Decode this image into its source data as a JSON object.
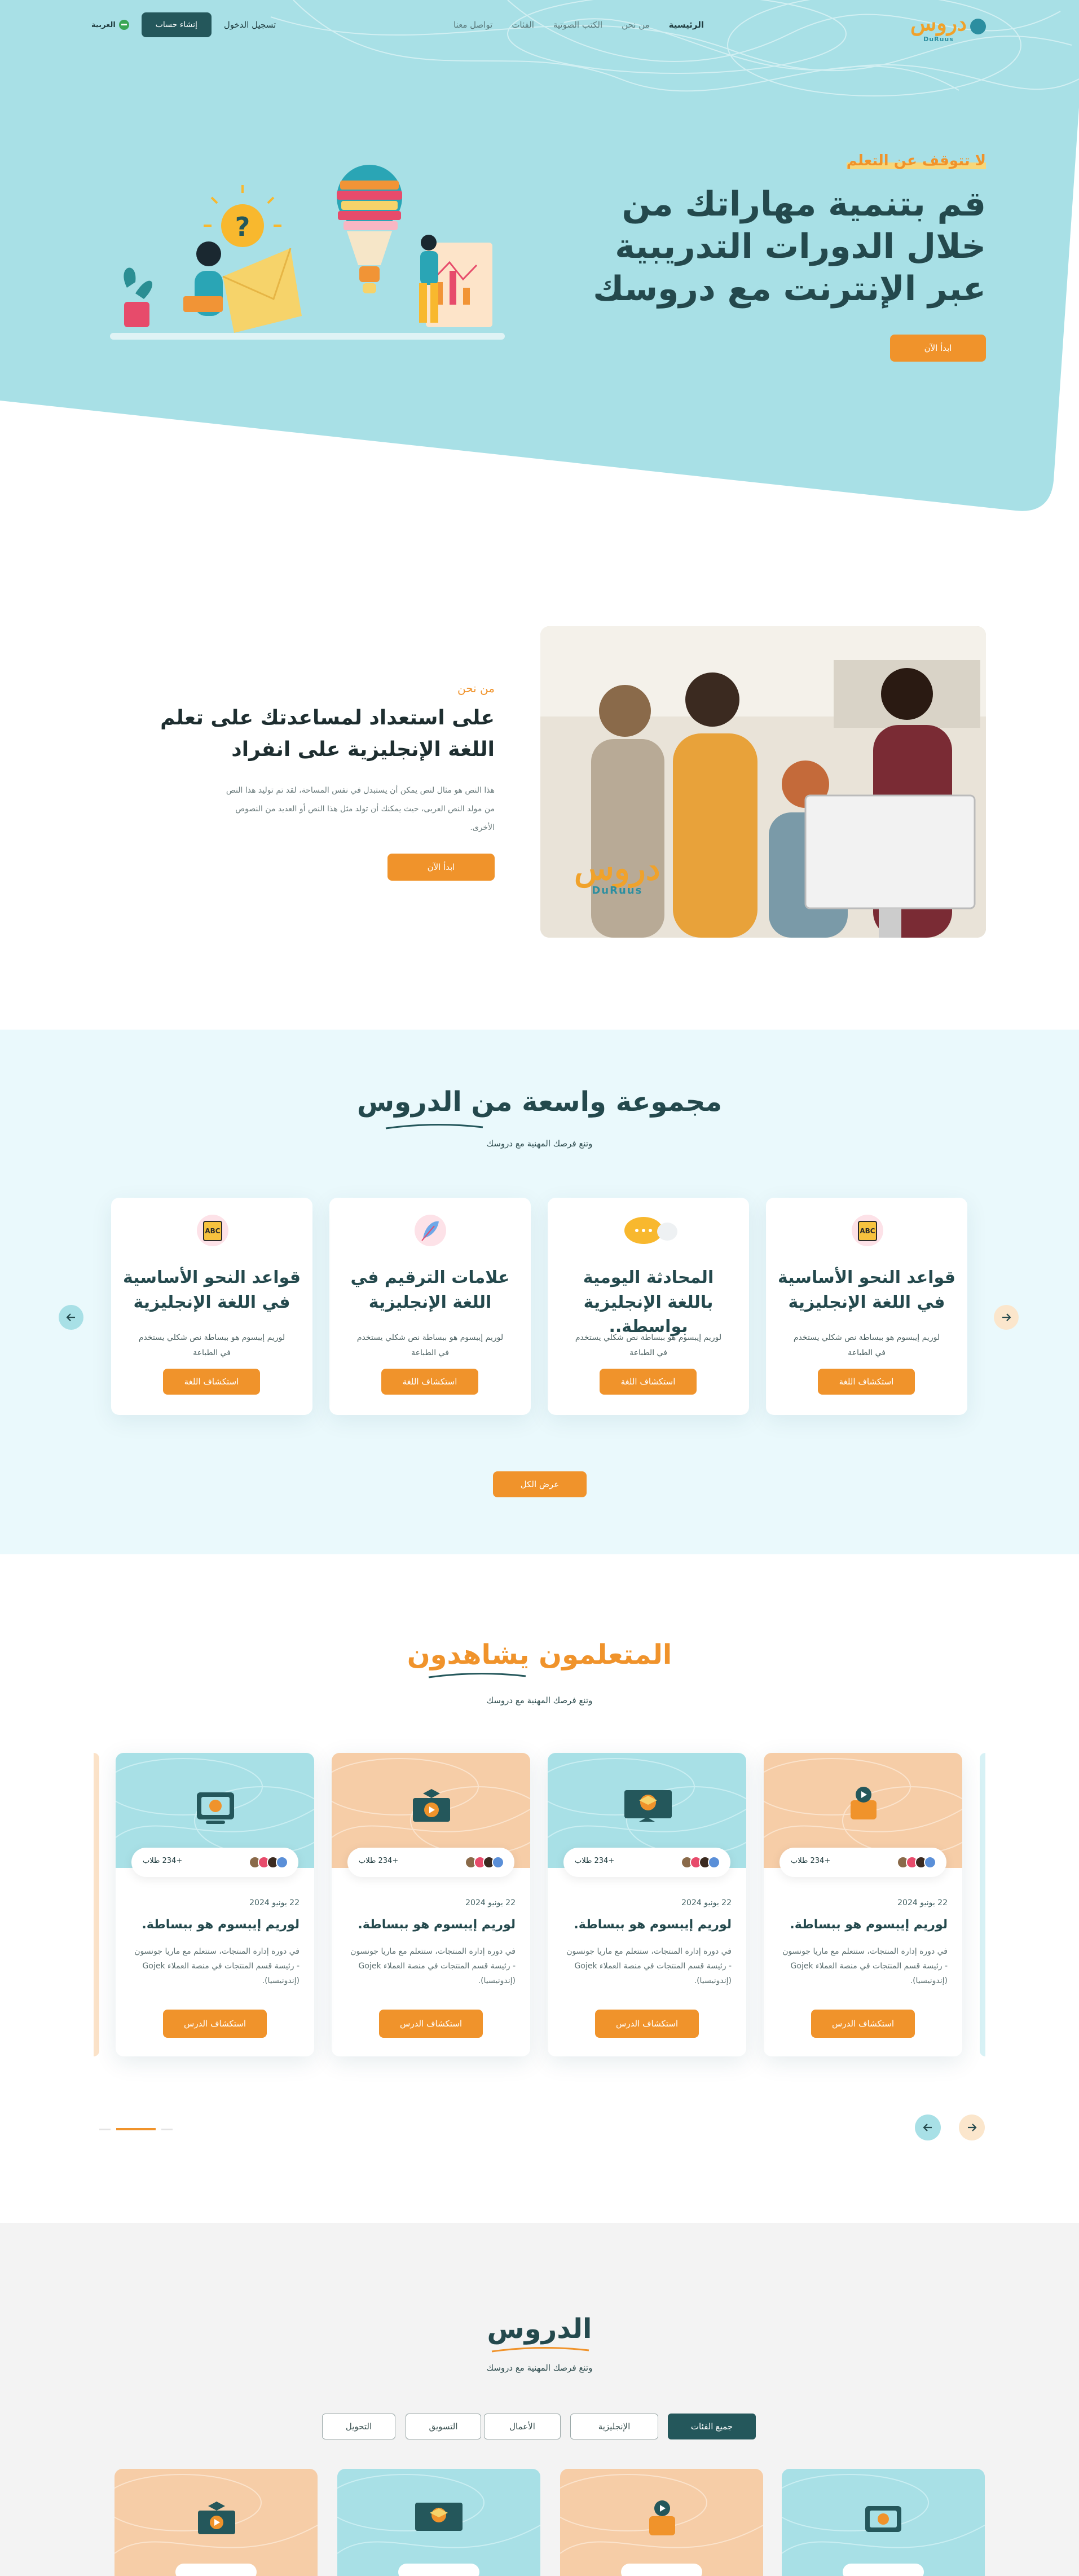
{
  "nav": {
    "logo_text": "دروس",
    "logo_latin": "DuRuus",
    "links": [
      "الرئيسية",
      "من نحن",
      "الكتب الصوتية",
      "الفئات",
      "تواصل معنا"
    ],
    "login": "تسجيل الدخول",
    "register": "إنشاء حساب",
    "language": "العربية"
  },
  "hero": {
    "tagline": "لا تتوقف عن التعلم",
    "title": "قم بتنمية مهاراتك من خلال الدورات التدريبية عبر الإنترنت مع دروسك",
    "cta": "ابدأ الآن"
  },
  "about": {
    "label": "من نحن",
    "title": "على استعداد لمساعدتك على تعلم اللغة الإنجليزية على انفراد",
    "body": "هذا النص هو مثال لنص يمكن أن يستبدل في نفس المساحة، لقد تم توليد هذا النص من مولد النص العربى، حيث يمكنك أن تولد مثل هذا النص أو العديد من النصوص الأخرى.",
    "cta": "ابدأ الآن",
    "image_logo": "دروس",
    "image_logo_latin": "DuRuus"
  },
  "courses": {
    "title": "مجموعة واسعة من الدروس",
    "subtitle": "وتنع فرصك المهنية مع دروسك",
    "cards": [
      {
        "title": "قواعد النحو الأساسية في اللغة الإنجليزية",
        "desc": "لوريم إيبسوم هو ببساطة نص شكلي يستخدم في الطباعة",
        "button": "استكشاف اللغة",
        "icon": "abc-book-icon"
      },
      {
        "title": "المحادثة اليومية باللغة الإنجليزية بواسطة..",
        "desc": "لوريم إيبسوم هو ببساطة نص شكلي يستخدم في الطباعة",
        "button": "استكشاف اللغة",
        "icon": "speech-bubbles-icon"
      },
      {
        "title": "علامات الترقيم في اللغة الإنجليزية",
        "desc": "لوريم إيبسوم هو ببساطة نص شكلي يستخدم في الطباعة",
        "button": "استكشاف اللغة",
        "icon": "feather-pen-icon"
      },
      {
        "title": "قواعد النحو الأساسية في اللغة الإنجليزية",
        "desc": "لوريم إيبسوم هو ببساطة نص شكلي يستخدم في الطباعة",
        "button": "استكشاف اللغة",
        "icon": "abc-book-icon"
      }
    ],
    "view_all": "عرض الكل"
  },
  "learners": {
    "title": "المتعلمون يشاهدون",
    "subtitle": "وتنع فرصك المهنية مع دروسك",
    "cards": [
      {
        "students": "+234 طلاب",
        "date": "22 يونيو 2024",
        "title": "لوريم إيبسوم هو ببساطة.",
        "desc": "في دورة إدارة المنتجات، ستتعلم مع ماريا جونسون - رئيسة قسم المنتجات في منصة العملاء Gojek (إندونيسيا).",
        "button": "استكشاف الدرس",
        "theme": "peach",
        "icon": "play-box-icon"
      },
      {
        "students": "+234 طلاب",
        "date": "22 يونيو 2024",
        "title": "لوريم إيبسوم هو ببساطة.",
        "desc": "في دورة إدارة المنتجات، ستتعلم مع ماريا جونسون - رئيسة قسم المنتجات في منصة العملاء Gojek (إندونيسيا).",
        "button": "استكشاف الدرس",
        "theme": "teal",
        "icon": "graduation-board-icon"
      },
      {
        "students": "+234 طلاب",
        "date": "22 يونيو 2024",
        "title": "لوريم إيبسوم هو ببساطة.",
        "desc": "في دورة إدارة المنتجات، ستتعلم مع ماريا جونسون - رئيسة قسم المنتجات في منصة العملاء Gojek (إندونيسيا).",
        "button": "استكشاف الدرس",
        "theme": "peach",
        "icon": "graduation-video-icon"
      },
      {
        "students": "+234 طلاب",
        "date": "22 يونيو 2024",
        "title": "لوريم إيبسوم هو ببساطة.",
        "desc": "في دورة إدارة المنتجات، ستتعلم مع ماريا جونسون - رئيسة قسم المنتجات في منصة العملاء Gojek (إندونيسيا).",
        "button": "استكشاف الدرس",
        "theme": "teal",
        "icon": "monitor-cap-icon"
      }
    ]
  },
  "lessons": {
    "title": "الدروس",
    "subtitle": "وتنع فرصك المهنية مع دروسك",
    "tabs": [
      "جميع الفئات",
      "الإنجليزية",
      "الأعمال",
      "التسويق",
      "التحويل"
    ]
  },
  "colors": {
    "teal": "#a8e0e6",
    "orange": "#f0932b",
    "dark_teal": "#24575b",
    "peach": "#f6cda7",
    "light_teal_bg": "#eaf9fc",
    "grey_bg": "#f3f3f3"
  }
}
